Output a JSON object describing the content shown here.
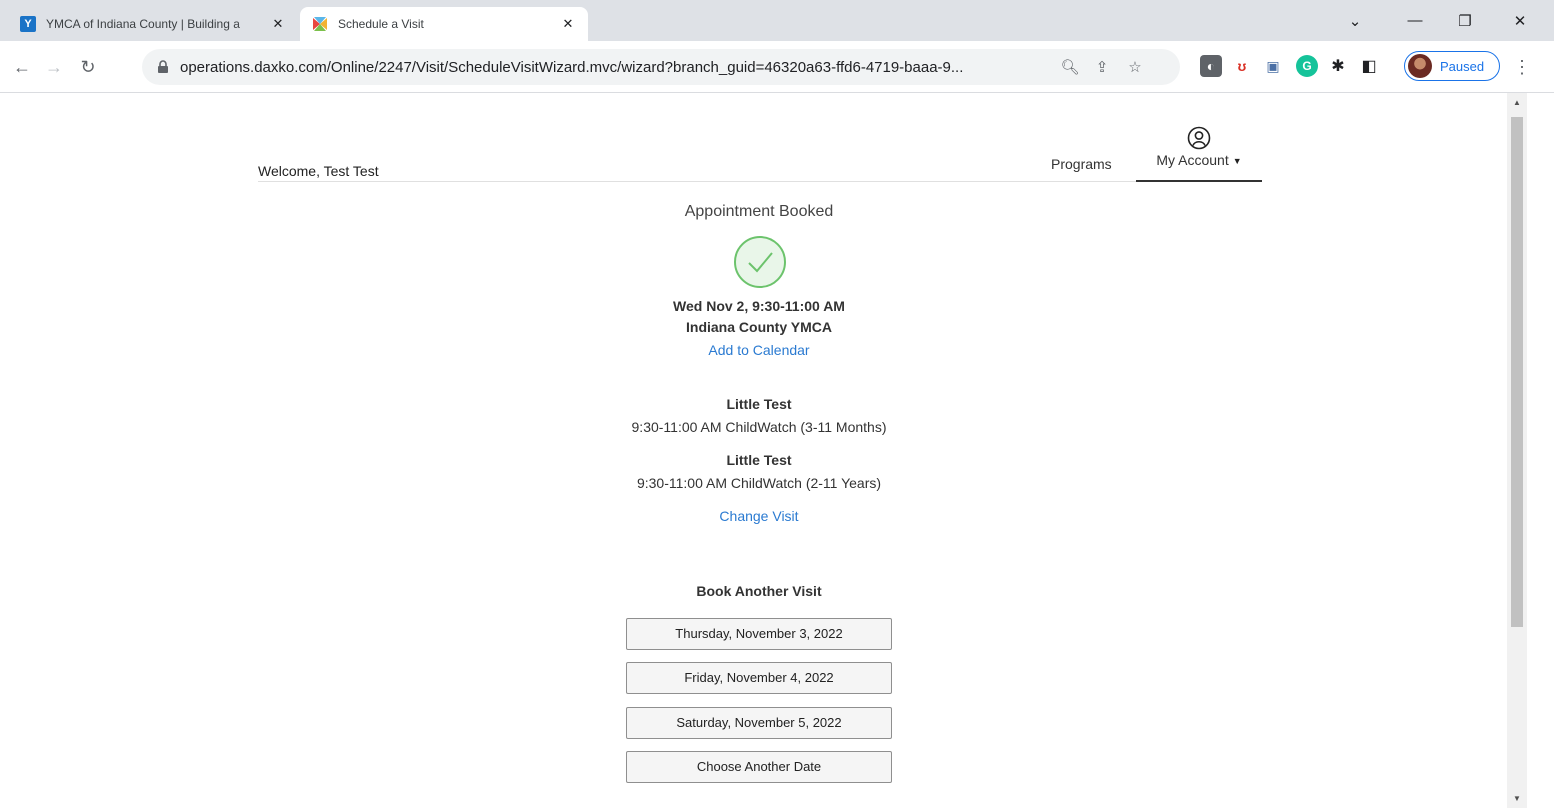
{
  "browser": {
    "tabs": [
      {
        "title": "YMCA of Indiana County | Building a",
        "favicon": "ymca-icon",
        "active": false
      },
      {
        "title": "Schedule a Visit",
        "favicon": "daxko-icon",
        "active": true
      }
    ],
    "url": "operations.daxko.com/Online/2247/Visit/ScheduleVisitWizard.mvc/wizard?branch_guid=46320a63-ffd6-4719-baaa-9...",
    "profile_label": "Paused",
    "accent_color": "#1a73e8"
  },
  "header": {
    "welcome": "Welcome, Test Test",
    "nav_programs": "Programs",
    "nav_account": "My Account"
  },
  "confirmation": {
    "title": "Appointment Booked",
    "check_color": "#6cc36c",
    "datetime": "Wed Nov 2, 9:30-11:00 AM",
    "location": "Indiana County YMCA",
    "add_to_calendar": "Add to Calendar",
    "attendees": [
      {
        "name": "Little Test",
        "detail": "9:30-11:00 AM ChildWatch (3-11 Months)"
      },
      {
        "name": "Little Test",
        "detail": "9:30-11:00 AM ChildWatch (2-11 Years)"
      }
    ],
    "change_visit": "Change Visit"
  },
  "book_another": {
    "title": "Book Another Visit",
    "options": [
      "Thursday, November 3, 2022",
      "Friday, November 4, 2022",
      "Saturday, November 5, 2022",
      "Choose Another Date"
    ]
  }
}
